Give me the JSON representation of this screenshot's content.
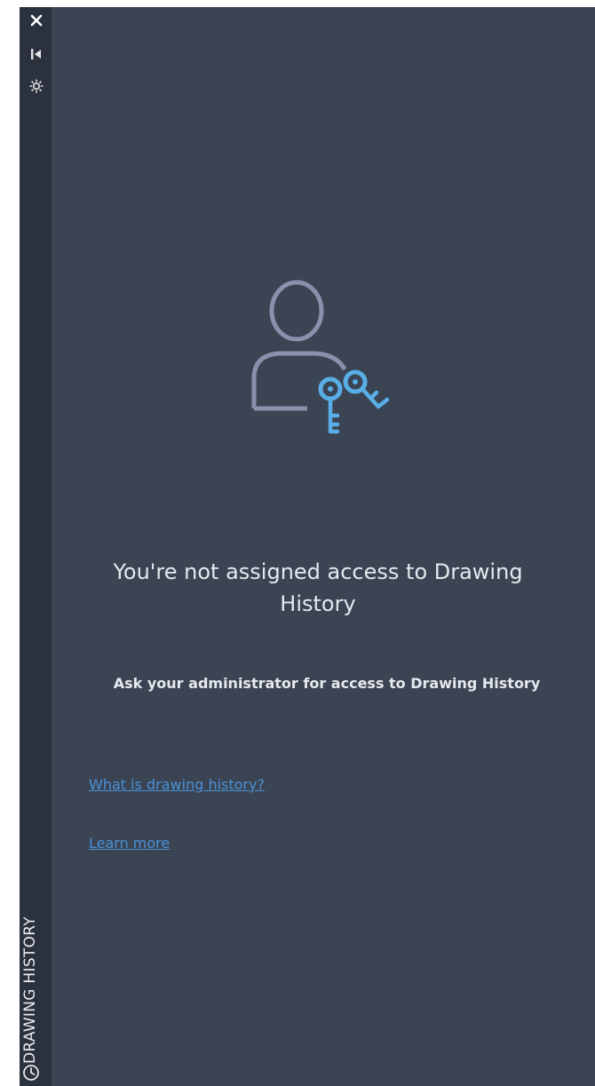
{
  "panel": {
    "title": "DRAWING HISTORY"
  },
  "toolbar": {
    "close_icon": "close-icon",
    "pin_icon": "auto-hide-icon",
    "settings_icon": "settings-icon"
  },
  "message": {
    "heading": "You're not assigned access to Drawing History",
    "body": "Ask your administrator for access to Drawing History",
    "illustration_icon": "user-keys-icon"
  },
  "links": {
    "what_is": "What is drawing history?",
    "learn_more": "Learn more"
  },
  "colors": {
    "background": "#3b4453",
    "sidebar": "#2b323d",
    "link": "#4a92d8",
    "key_accent": "#5aaee8",
    "user_outline": "#8a91ad"
  }
}
